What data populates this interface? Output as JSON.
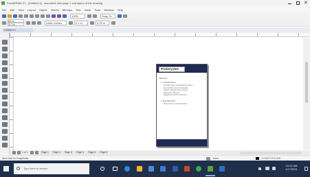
{
  "window": {
    "title": "CorelDRAW X7 - [Untitled-1] - document with page 1 and layers of the drawing",
    "controls": [
      "minimize",
      "maximize",
      "close"
    ]
  },
  "menubar": [
    "File",
    "Edit",
    "View",
    "Layout",
    "Object",
    "Effects",
    "Bitmaps",
    "Text",
    "Table",
    "Tools",
    "Window",
    "Help"
  ],
  "toolbar": {
    "zoom_value": "100%",
    "snap_label": "Snap To",
    "width_value": "8.5 in",
    "height_value": "11.0 in",
    "units_label": "Units: Inches",
    "nudge_value": "0.1 in",
    "dup_value": "0.25 in"
  },
  "doc_tab": "Untitled-1",
  "document": {
    "title": "Prokaryotes",
    "lines": [
      "Bacteria",
      "1. Cell Structure",
      "Cell wall made of peptidoglycan layers",
      "No membrane-bound organelles",
      "DNA in nucleoid region, circular",
      "Ribosomes 70S type",
      "Flagella and pili for movement",
      "2. Reproduction",
      "Binary fission, asexual division"
    ]
  },
  "page_nav": {
    "current": "1 of 1",
    "tabs": [
      "Page 1",
      "Page 2",
      "Page 3",
      "Page 4",
      "Page 5",
      "Page 6"
    ]
  },
  "statusbar": {
    "left": "Next click for Drag/Scale",
    "color_info": "C:0 M:0 Y:0 K:100",
    "fill_info": "None"
  },
  "taskbar": {
    "search_placeholder": "Type here to search",
    "time": "10:30 AM",
    "date": "1/17/2021"
  }
}
